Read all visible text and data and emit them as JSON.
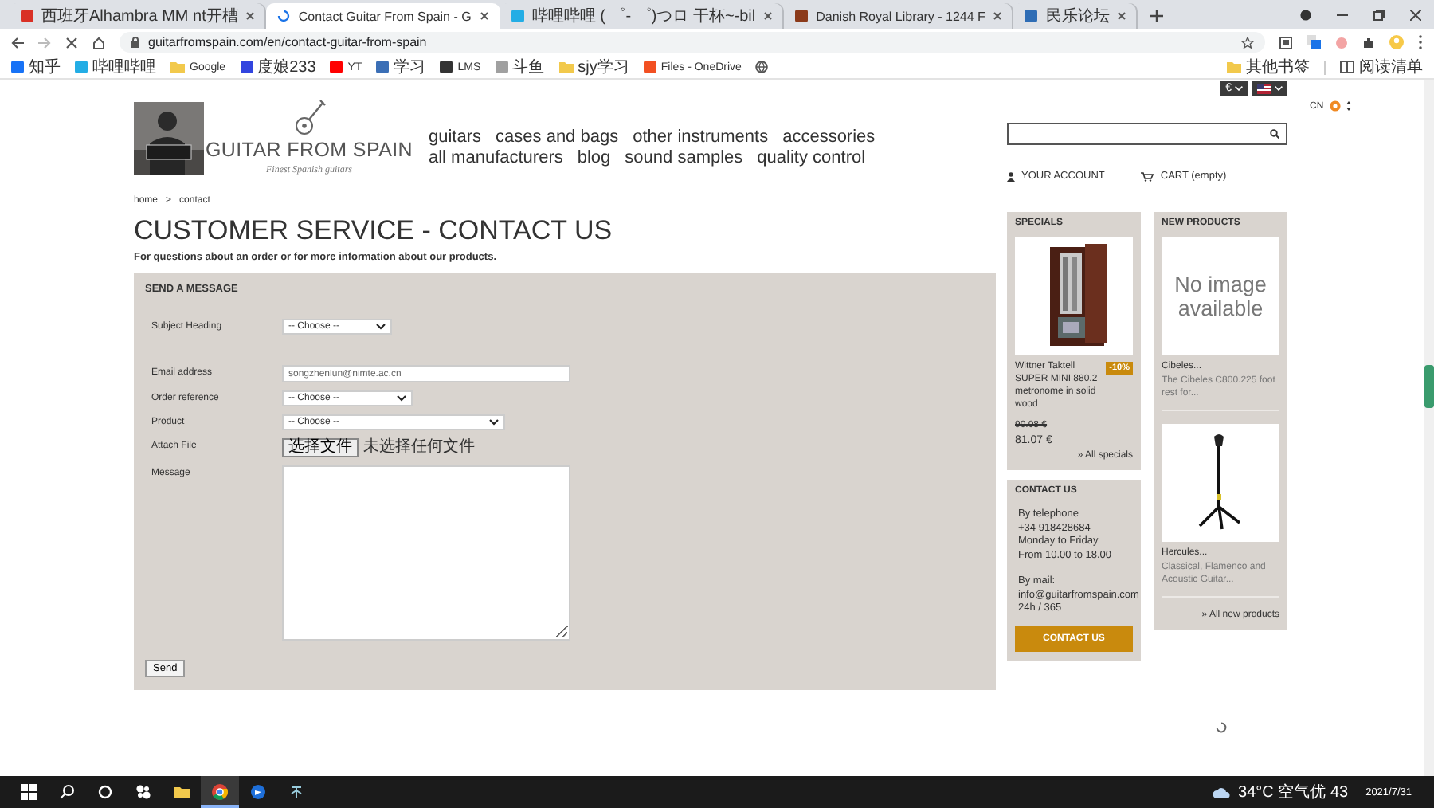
{
  "browser": {
    "tabs": [
      {
        "title": "西班牙Alhambra MM nt开槽",
        "selected": false,
        "kind": "favicon",
        "color": "#d93025"
      },
      {
        "title": "Contact Guitar From Spain - G",
        "selected": true,
        "kind": "loading"
      },
      {
        "title": "哔哩哔哩 ( ゜- ゜)つロ 干杯~-bil",
        "selected": false,
        "kind": "favicon",
        "color": "#23ade5"
      },
      {
        "title": "Danish Royal Library - 1244 F",
        "selected": false,
        "kind": "favicon",
        "color": "#8b3a1a"
      },
      {
        "title": "民乐论坛",
        "selected": false,
        "kind": "favicon",
        "color": "#2f6db5"
      }
    ],
    "url": "guitarfromspain.com/en/contact-guitar-from-spain",
    "bookmarks": [
      {
        "label": "知乎",
        "kind": "site",
        "color": "#1772f6"
      },
      {
        "label": "哔哩哔哩",
        "kind": "site",
        "color": "#23ade5"
      },
      {
        "label": "Google",
        "kind": "folder"
      },
      {
        "label": "度娘233",
        "kind": "site",
        "color": "#3245df"
      },
      {
        "label": "YT",
        "kind": "site",
        "color": "#ff0000"
      },
      {
        "label": "学习",
        "kind": "site",
        "color": "#3b6fb6"
      },
      {
        "label": "LMS",
        "kind": "site",
        "color": "#333333"
      },
      {
        "label": "斗鱼",
        "kind": "site",
        "color": "#a0a0a0"
      },
      {
        "label": "sjy学习",
        "kind": "folder"
      },
      {
        "label": "Files - OneDrive",
        "kind": "site",
        "color": "#f25022"
      },
      {
        "kind": "globe"
      }
    ],
    "bookmarks_right": [
      {
        "label": "其他书签",
        "kind": "folder"
      },
      {
        "label": "阅读清单",
        "kind": "list"
      }
    ]
  },
  "site": {
    "currency": "€",
    "language": "CN",
    "logo": {
      "name": "GUITAR FROM SPAIN",
      "tagline": "Finest Spanish guitars"
    },
    "menu": [
      {
        "items": [
          "guitars",
          "cases and bags",
          "other instruments",
          "accessories"
        ]
      },
      {
        "items": [
          "all manufacturers",
          "blog",
          "sound samples",
          "quality control"
        ]
      }
    ],
    "account": "YOUR ACCOUNT",
    "cart": "CART (empty)",
    "breadcrumb": {
      "items": [
        "home",
        "contact"
      ],
      "separator": ">"
    },
    "title": "CUSTOMER SERVICE - CONTACT US",
    "intro": "For questions about an order or for more information about our products.",
    "form": {
      "heading": "SEND A MESSAGE",
      "fields": [
        {
          "label": "Subject Heading",
          "kind": "select",
          "value": "-- Choose --"
        },
        {
          "label": "Email address",
          "kind": "input",
          "value": "songzhenlun@nimte.ac.cn"
        },
        {
          "label": "Order reference",
          "kind": "select",
          "value": "-- Choose --"
        },
        {
          "label": "Product",
          "kind": "select",
          "value": "-- Choose --"
        },
        {
          "label": "Attach File",
          "kind": "file",
          "button": "选择文件",
          "value": "未选择任何文件"
        },
        {
          "label": "Message",
          "kind": "textarea"
        }
      ],
      "submit": "Send"
    },
    "specials": {
      "heading": "SPECIALS",
      "product": "Wittner Taktell SUPER MINI 880.2 metronome in solid wood",
      "discount": "-10%",
      "old_price": "90.08 €",
      "price": "81.07 €",
      "link": "» All specials"
    },
    "contact": {
      "heading": "CONTACT US",
      "blocks": [
        {
          "lines": [
            "By telephone",
            "+34 918428684",
            "Monday to Friday",
            "From 10.00 to 18.00"
          ]
        },
        {
          "lines": [
            "By mail:",
            "info@guitarfromspain.com",
            "24h / 365"
          ]
        }
      ],
      "button": "CONTACT US"
    },
    "new_products": {
      "heading": "NEW PRODUCTS",
      "items": [
        {
          "kind": "no_image",
          "image_text": "No image available",
          "name": "Cibeles...",
          "description": "The Cibeles C800.225 foot rest for..."
        },
        {
          "kind": "picture",
          "name": "Hercules...",
          "description": "Classical, Flamenco and Acoustic Guitar..."
        }
      ],
      "link": "» All new products"
    }
  },
  "taskbar": {
    "weather": "34°C 空气优 43",
    "date": "2021/7/31"
  }
}
